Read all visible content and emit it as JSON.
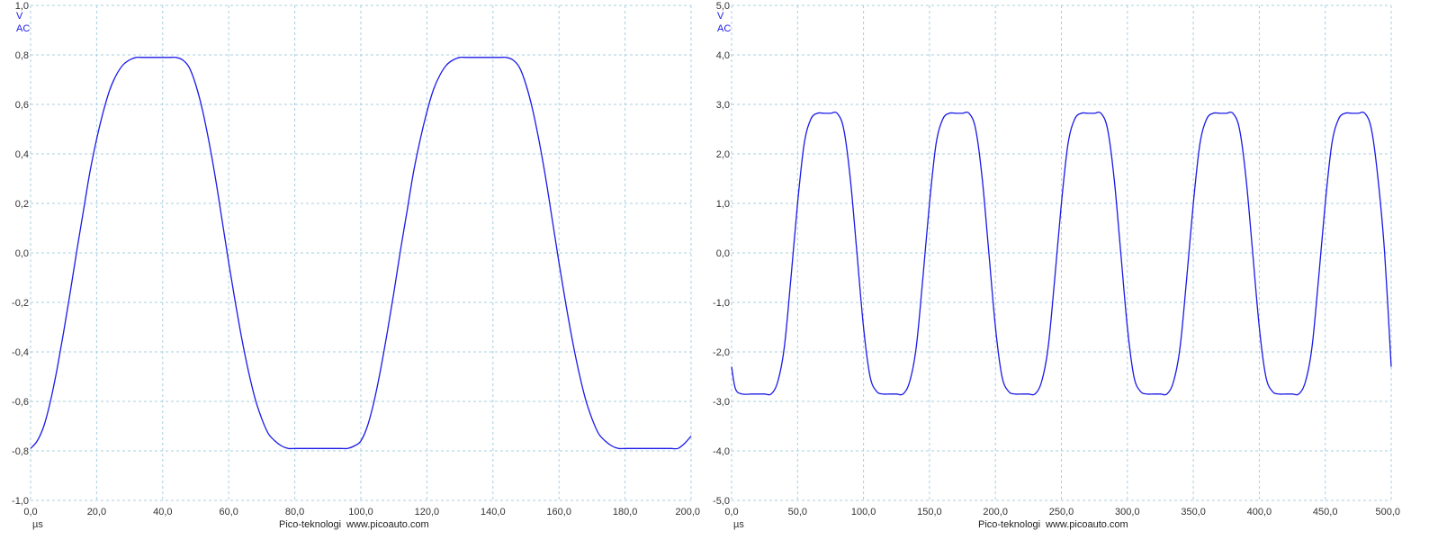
{
  "app": {
    "brand": "Pico-teknologi",
    "url": "www.picoauto.com"
  },
  "colors": {
    "trace": "#1a1ae6",
    "grid": "#a8cfe0",
    "unit_text": "#1a1ae6"
  },
  "chart_data": [
    {
      "type": "line",
      "title": "",
      "ylabel_unit": "V",
      "ylabel_coupling": "AC",
      "xlabel_unit": "µs",
      "xlim": [
        0,
        200
      ],
      "ylim": [
        -1.0,
        1.0
      ],
      "x_ticks": [
        "0,0",
        "20,0",
        "40,0",
        "60,0",
        "80,0",
        "100,0",
        "120,0",
        "140,0",
        "160,0",
        "180,0",
        "200,0"
      ],
      "y_ticks": [
        "1,0",
        "0,8",
        "0,6",
        "0,4",
        "0,2",
        "0,0",
        "-0,2",
        "-0,4",
        "-0,6",
        "-0,8",
        "-1,0"
      ],
      "grid": true,
      "series": [
        {
          "x": [
            0,
            2,
            4,
            6,
            8,
            10,
            12,
            14,
            16,
            18,
            20,
            22,
            24,
            26,
            28,
            30,
            32,
            34,
            36,
            38,
            40,
            42,
            44,
            46,
            48,
            50,
            52,
            54,
            56,
            58,
            60,
            62,
            64,
            66,
            68,
            70,
            72,
            74,
            76,
            78,
            80,
            82,
            84,
            86,
            88,
            90,
            92,
            94,
            96,
            98,
            100,
            102,
            104,
            106,
            108,
            110,
            112,
            114,
            116,
            118,
            120,
            122,
            124,
            126,
            128,
            130,
            132,
            134,
            136,
            138,
            140,
            142,
            144,
            146,
            148,
            150,
            152,
            154,
            156,
            158,
            160,
            162,
            164,
            166,
            168,
            170,
            172,
            174,
            176,
            178,
            180,
            182,
            184,
            186,
            188,
            190,
            192,
            194,
            196,
            198,
            200
          ],
          "y": [
            -0.79,
            -0.76,
            -0.7,
            -0.6,
            -0.47,
            -0.32,
            -0.16,
            0.01,
            0.17,
            0.33,
            0.46,
            0.57,
            0.66,
            0.72,
            0.76,
            0.78,
            0.79,
            0.79,
            0.79,
            0.79,
            0.79,
            0.79,
            0.79,
            0.78,
            0.75,
            0.68,
            0.58,
            0.45,
            0.3,
            0.13,
            -0.04,
            -0.2,
            -0.35,
            -0.48,
            -0.59,
            -0.67,
            -0.73,
            -0.76,
            -0.78,
            -0.79,
            -0.79,
            -0.79,
            -0.79,
            -0.79,
            -0.79,
            -0.79,
            -0.79,
            -0.79,
            -0.79,
            -0.78,
            -0.76,
            -0.7,
            -0.6,
            -0.47,
            -0.32,
            -0.16,
            0.01,
            0.17,
            0.33,
            0.46,
            0.57,
            0.66,
            0.72,
            0.76,
            0.78,
            0.79,
            0.79,
            0.79,
            0.79,
            0.79,
            0.79,
            0.79,
            0.79,
            0.78,
            0.75,
            0.68,
            0.58,
            0.45,
            0.3,
            0.13,
            -0.04,
            -0.2,
            -0.35,
            -0.48,
            -0.59,
            -0.67,
            -0.73,
            -0.76,
            -0.78,
            -0.79,
            -0.79,
            -0.79,
            -0.79,
            -0.79,
            -0.79,
            -0.79,
            -0.79,
            -0.79,
            -0.79,
            -0.77,
            -0.74
          ]
        }
      ]
    },
    {
      "type": "line",
      "title": "",
      "ylabel_unit": "V",
      "ylabel_coupling": "AC",
      "xlabel_unit": "µs",
      "xlim": [
        0,
        500
      ],
      "ylim": [
        -5.0,
        5.0
      ],
      "x_ticks": [
        "0,0",
        "50,0",
        "100,0",
        "150,0",
        "200,0",
        "250,0",
        "300,0",
        "350,0",
        "400,0",
        "450,0",
        "500,0"
      ],
      "y_ticks": [
        "5,0",
        "4,0",
        "3,0",
        "2,0",
        "1,0",
        "0,0",
        "-1,0",
        "-2,0",
        "-3,0",
        "-4,0",
        "-5,0"
      ],
      "grid": true,
      "series": [
        {
          "x": [
            0,
            3,
            8,
            15,
            20,
            25,
            30,
            35,
            40,
            45,
            50,
            55,
            60,
            65,
            70,
            75,
            80,
            85,
            90,
            95,
            100,
            105,
            110,
            115,
            120,
            125,
            130,
            135,
            140,
            145,
            150,
            155,
            160,
            165,
            170,
            175,
            180,
            185,
            190,
            195,
            200,
            205,
            210,
            215,
            220,
            225,
            230,
            235,
            240,
            245,
            250,
            255,
            260,
            265,
            270,
            275,
            280,
            285,
            290,
            295,
            300,
            305,
            310,
            315,
            320,
            325,
            330,
            335,
            340,
            345,
            350,
            355,
            360,
            365,
            370,
            375,
            380,
            385,
            390,
            395,
            400,
            405,
            410,
            415,
            420,
            425,
            430,
            435,
            440,
            445,
            450,
            455,
            460,
            465,
            470,
            475,
            480,
            485,
            490,
            495,
            500
          ],
          "y": [
            -2.3,
            -2.75,
            -2.85,
            -2.85,
            -2.85,
            -2.85,
            -2.85,
            -2.6,
            -1.9,
            -0.5,
            1.0,
            2.2,
            2.7,
            2.82,
            2.82,
            2.82,
            2.82,
            2.5,
            1.5,
            0.0,
            -1.5,
            -2.5,
            -2.8,
            -2.85,
            -2.85,
            -2.85,
            -2.85,
            -2.6,
            -1.9,
            -0.5,
            1.0,
            2.2,
            2.7,
            2.82,
            2.82,
            2.82,
            2.82,
            2.5,
            1.5,
            0.0,
            -1.5,
            -2.5,
            -2.8,
            -2.85,
            -2.85,
            -2.85,
            -2.85,
            -2.6,
            -1.9,
            -0.5,
            1.0,
            2.2,
            2.7,
            2.82,
            2.82,
            2.82,
            2.82,
            2.5,
            1.5,
            0.0,
            -1.5,
            -2.5,
            -2.8,
            -2.85,
            -2.85,
            -2.85,
            -2.85,
            -2.6,
            -1.9,
            -0.5,
            1.0,
            2.2,
            2.7,
            2.82,
            2.82,
            2.82,
            2.82,
            2.5,
            1.5,
            0.0,
            -1.5,
            -2.5,
            -2.8,
            -2.85,
            -2.85,
            -2.85,
            -2.85,
            -2.6,
            -1.9,
            -0.5,
            1.0,
            2.2,
            2.7,
            2.82,
            2.82,
            2.82,
            2.82,
            2.5,
            1.5,
            0.0,
            -2.3
          ]
        }
      ]
    }
  ]
}
